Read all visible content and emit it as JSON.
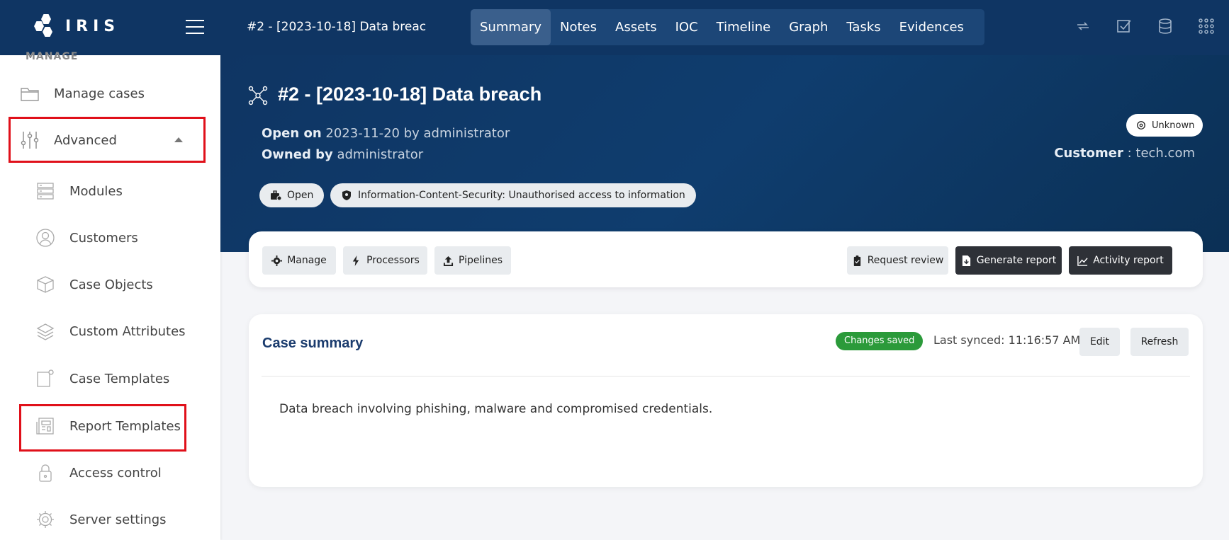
{
  "app": {
    "logo_text": "IRIS"
  },
  "topbar": {
    "case_title": "#2 - [2023-10-18] Data breac",
    "tabs": [
      "Summary",
      "Notes",
      "Assets",
      "IOC",
      "Timeline",
      "Graph",
      "Tasks",
      "Evidences"
    ],
    "active_tab": "Summary",
    "icons": [
      "refresh-icon",
      "checkbox-icon",
      "database-icon",
      "apps-grid-icon"
    ]
  },
  "sidebar": {
    "section_label": "MANAGE",
    "items": [
      {
        "label": "Manage cases",
        "icon": "folder-icon"
      },
      {
        "label": "Advanced",
        "icon": "sliders-icon"
      },
      {
        "label": "Modules",
        "icon": "server-icon"
      },
      {
        "label": "Customers",
        "icon": "user-circle-icon"
      },
      {
        "label": "Case Objects",
        "icon": "box-icon"
      },
      {
        "label": "Custom Attributes",
        "icon": "layers-icon"
      },
      {
        "label": "Case Templates",
        "icon": "template-icon"
      },
      {
        "label": "Report Templates",
        "icon": "newspaper-icon"
      },
      {
        "label": "Access control",
        "icon": "lock-icon"
      },
      {
        "label": "Server settings",
        "icon": "gear-icon"
      }
    ]
  },
  "case": {
    "title": "#2 - [2023-10-18] Data breach",
    "open_on_label": "Open on",
    "open_on_value": "2023-11-20 by administrator",
    "owned_by_label": "Owned by",
    "owned_by_value": "administrator",
    "status_pill": "Open",
    "classification_pill": "Information-Content-Security: Unauthorised access to information",
    "severity_badge": "Unknown",
    "customer_label": "Customer",
    "customer_value": ": tech.com"
  },
  "actions": {
    "manage": "Manage",
    "processors": "Processors",
    "pipelines": "Pipelines",
    "request_review": "Request review",
    "generate_report": "Generate report",
    "activity_report": "Activity report"
  },
  "summary": {
    "title": "Case summary",
    "saved_badge": "Changes saved",
    "last_synced": "Last synced: 11:16:57 AM",
    "edit": "Edit",
    "refresh": "Refresh",
    "text": "Data breach involving phishing, malware and compromised credentials."
  },
  "colors": {
    "topbar": "#0f3563",
    "highlight": "#e0101a",
    "saved_badge": "#2b9a3a",
    "dark_button": "#2e3137"
  }
}
